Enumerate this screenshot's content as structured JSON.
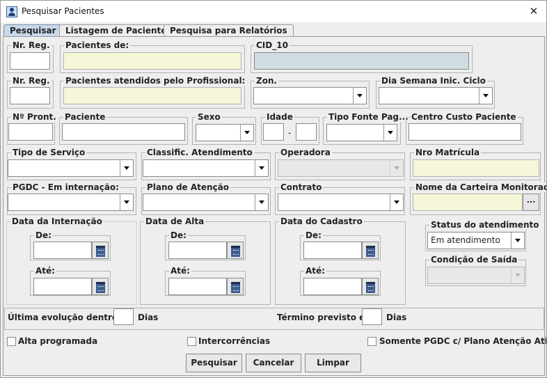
{
  "window": {
    "title": "Pesquisar Pacientes"
  },
  "tabs": [
    "Pesquisar",
    "Listagem de Pacientes",
    "Pesquisa para Relatórios"
  ],
  "fields": {
    "nr_reg_1": "Nr. Reg.",
    "pacientes_de": "Pacientes de:",
    "cid10": "CID_10",
    "nr_reg_2": "Nr. Reg.",
    "pac_atendidos": "Pacientes atendidos pelo Profissional:",
    "zon": "Zon.",
    "dia_semana": "Dia Semana Inic. Ciclo",
    "n_pront": "Nº Pront.",
    "paciente": "Paciente",
    "sexo": "Sexo",
    "idade": "Idade",
    "idade_sep": "-",
    "tipo_fonte": "Tipo Fonte Pag...",
    "centro_custo": "Centro Custo Paciente",
    "tipo_servico": "Tipo de Serviço",
    "classif": "Classific. Atendimento",
    "operadora": "Operadora",
    "nro_matricula": "Nro Matrícula",
    "pgdc": "PGDC - Em internação:",
    "plano_atencao": "Plano de Atenção",
    "contrato": "Contrato",
    "carteira": "Nome da Carteira Monitorada"
  },
  "dates": {
    "internacao": "Data da Internação",
    "alta": "Data de Alta",
    "cadastro": "Data do Cadastro",
    "de": "De:",
    "ate": "Até:"
  },
  "status": {
    "label": "Status do atendimento",
    "value": "Em atendimento",
    "saida": "Condição de Saída"
  },
  "evolution": {
    "ultima": "Última evolução dentro de",
    "dias1": "Dias",
    "termino": "Término previsto em",
    "dias2": "Dias"
  },
  "checkboxes": {
    "alta": "Alta programada",
    "intercorrencias": "Intercorrências",
    "somente": "Somente PGDC c/ Plano Atenção Ativo"
  },
  "buttons": {
    "pesquisar": "Pesquisar",
    "cancelar": "Cancelar",
    "limpar": "Limpar",
    "dots": "..."
  },
  "icons": {
    "app": "patient-search-icon",
    "close": "close-icon",
    "calendar": "calendar-icon"
  },
  "colors": {
    "tab_active": "#c8d8ec",
    "field_yellow": "#f6f6d8",
    "field_blue": "#cfdde3"
  }
}
